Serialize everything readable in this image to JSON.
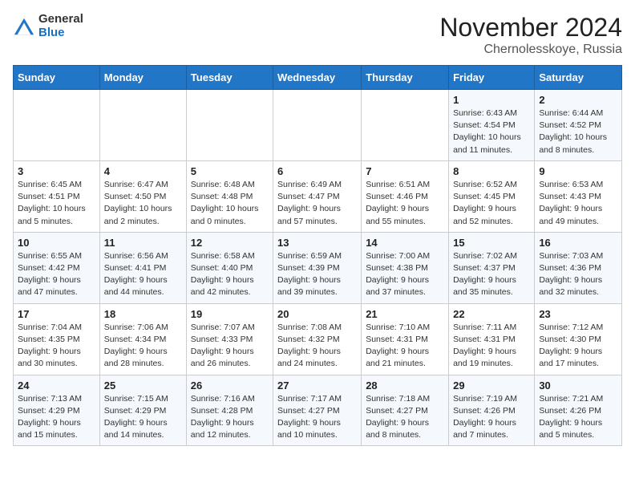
{
  "header": {
    "logo": {
      "general": "General",
      "blue": "Blue"
    },
    "title": "November 2024",
    "location": "Chernolesskoye, Russia"
  },
  "weekdays": [
    "Sunday",
    "Monday",
    "Tuesday",
    "Wednesday",
    "Thursday",
    "Friday",
    "Saturday"
  ],
  "weeks": [
    [
      {
        "day": "",
        "info": ""
      },
      {
        "day": "",
        "info": ""
      },
      {
        "day": "",
        "info": ""
      },
      {
        "day": "",
        "info": ""
      },
      {
        "day": "",
        "info": ""
      },
      {
        "day": "1",
        "info": "Sunrise: 6:43 AM\nSunset: 4:54 PM\nDaylight: 10 hours and 11 minutes."
      },
      {
        "day": "2",
        "info": "Sunrise: 6:44 AM\nSunset: 4:52 PM\nDaylight: 10 hours and 8 minutes."
      }
    ],
    [
      {
        "day": "3",
        "info": "Sunrise: 6:45 AM\nSunset: 4:51 PM\nDaylight: 10 hours and 5 minutes."
      },
      {
        "day": "4",
        "info": "Sunrise: 6:47 AM\nSunset: 4:50 PM\nDaylight: 10 hours and 2 minutes."
      },
      {
        "day": "5",
        "info": "Sunrise: 6:48 AM\nSunset: 4:48 PM\nDaylight: 10 hours and 0 minutes."
      },
      {
        "day": "6",
        "info": "Sunrise: 6:49 AM\nSunset: 4:47 PM\nDaylight: 9 hours and 57 minutes."
      },
      {
        "day": "7",
        "info": "Sunrise: 6:51 AM\nSunset: 4:46 PM\nDaylight: 9 hours and 55 minutes."
      },
      {
        "day": "8",
        "info": "Sunrise: 6:52 AM\nSunset: 4:45 PM\nDaylight: 9 hours and 52 minutes."
      },
      {
        "day": "9",
        "info": "Sunrise: 6:53 AM\nSunset: 4:43 PM\nDaylight: 9 hours and 49 minutes."
      }
    ],
    [
      {
        "day": "10",
        "info": "Sunrise: 6:55 AM\nSunset: 4:42 PM\nDaylight: 9 hours and 47 minutes."
      },
      {
        "day": "11",
        "info": "Sunrise: 6:56 AM\nSunset: 4:41 PM\nDaylight: 9 hours and 44 minutes."
      },
      {
        "day": "12",
        "info": "Sunrise: 6:58 AM\nSunset: 4:40 PM\nDaylight: 9 hours and 42 minutes."
      },
      {
        "day": "13",
        "info": "Sunrise: 6:59 AM\nSunset: 4:39 PM\nDaylight: 9 hours and 39 minutes."
      },
      {
        "day": "14",
        "info": "Sunrise: 7:00 AM\nSunset: 4:38 PM\nDaylight: 9 hours and 37 minutes."
      },
      {
        "day": "15",
        "info": "Sunrise: 7:02 AM\nSunset: 4:37 PM\nDaylight: 9 hours and 35 minutes."
      },
      {
        "day": "16",
        "info": "Sunrise: 7:03 AM\nSunset: 4:36 PM\nDaylight: 9 hours and 32 minutes."
      }
    ],
    [
      {
        "day": "17",
        "info": "Sunrise: 7:04 AM\nSunset: 4:35 PM\nDaylight: 9 hours and 30 minutes."
      },
      {
        "day": "18",
        "info": "Sunrise: 7:06 AM\nSunset: 4:34 PM\nDaylight: 9 hours and 28 minutes."
      },
      {
        "day": "19",
        "info": "Sunrise: 7:07 AM\nSunset: 4:33 PM\nDaylight: 9 hours and 26 minutes."
      },
      {
        "day": "20",
        "info": "Sunrise: 7:08 AM\nSunset: 4:32 PM\nDaylight: 9 hours and 24 minutes."
      },
      {
        "day": "21",
        "info": "Sunrise: 7:10 AM\nSunset: 4:31 PM\nDaylight: 9 hours and 21 minutes."
      },
      {
        "day": "22",
        "info": "Sunrise: 7:11 AM\nSunset: 4:31 PM\nDaylight: 9 hours and 19 minutes."
      },
      {
        "day": "23",
        "info": "Sunrise: 7:12 AM\nSunset: 4:30 PM\nDaylight: 9 hours and 17 minutes."
      }
    ],
    [
      {
        "day": "24",
        "info": "Sunrise: 7:13 AM\nSunset: 4:29 PM\nDaylight: 9 hours and 15 minutes."
      },
      {
        "day": "25",
        "info": "Sunrise: 7:15 AM\nSunset: 4:29 PM\nDaylight: 9 hours and 14 minutes."
      },
      {
        "day": "26",
        "info": "Sunrise: 7:16 AM\nSunset: 4:28 PM\nDaylight: 9 hours and 12 minutes."
      },
      {
        "day": "27",
        "info": "Sunrise: 7:17 AM\nSunset: 4:27 PM\nDaylight: 9 hours and 10 minutes."
      },
      {
        "day": "28",
        "info": "Sunrise: 7:18 AM\nSunset: 4:27 PM\nDaylight: 9 hours and 8 minutes."
      },
      {
        "day": "29",
        "info": "Sunrise: 7:19 AM\nSunset: 4:26 PM\nDaylight: 9 hours and 7 minutes."
      },
      {
        "day": "30",
        "info": "Sunrise: 7:21 AM\nSunset: 4:26 PM\nDaylight: 9 hours and 5 minutes."
      }
    ]
  ]
}
